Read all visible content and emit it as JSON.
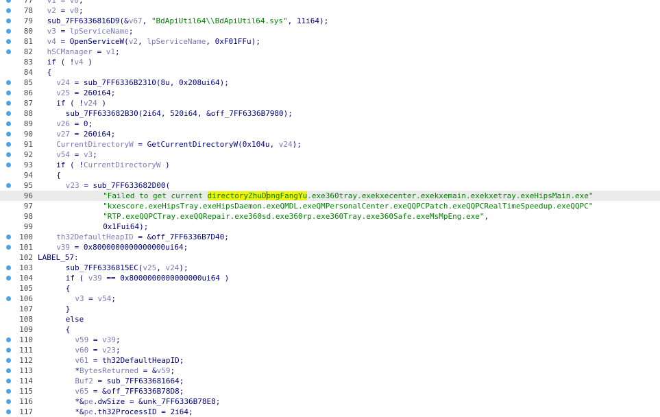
{
  "colors": {
    "background": "#ffffff",
    "breakpoint": "#4aa3e6",
    "code": "#000080",
    "variable": "#7a7ab8",
    "string": "#008000",
    "highlight": "#f2f200",
    "current_line": "#ebebeb"
  },
  "editor": {
    "cursor_line": 96,
    "lines": [
      {
        "n": "77",
        "bp": true,
        "indent": 2,
        "tokens": [
          [
            "var",
            "v1"
          ],
          [
            "plain",
            " = "
          ],
          [
            "var",
            "v0"
          ],
          [
            "plain",
            ";"
          ]
        ]
      },
      {
        "n": "78",
        "bp": true,
        "indent": 2,
        "tokens": [
          [
            "var",
            "v2"
          ],
          [
            "plain",
            " = "
          ],
          [
            "var",
            "v0"
          ],
          [
            "plain",
            ";"
          ]
        ]
      },
      {
        "n": "79",
        "bp": true,
        "indent": 2,
        "tokens": [
          [
            "plain",
            "sub_7FF6336816D9(&"
          ],
          [
            "var",
            "v67"
          ],
          [
            "plain",
            ", "
          ],
          [
            "str",
            "\"BdApiUtil64\\\\BdApiUtil64.sys\""
          ],
          [
            "plain",
            ", 11i64);"
          ]
        ]
      },
      {
        "n": "80",
        "bp": true,
        "indent": 2,
        "tokens": [
          [
            "var",
            "v3"
          ],
          [
            "plain",
            " = "
          ],
          [
            "var",
            "lpServiceName"
          ],
          [
            "plain",
            ";"
          ]
        ]
      },
      {
        "n": "81",
        "bp": true,
        "indent": 2,
        "tokens": [
          [
            "var",
            "v4"
          ],
          [
            "plain",
            " = OpenServiceW("
          ],
          [
            "var",
            "v2"
          ],
          [
            "plain",
            ", "
          ],
          [
            "var",
            "lpServiceName"
          ],
          [
            "plain",
            ", 0xF01FFu);"
          ]
        ]
      },
      {
        "n": "82",
        "bp": true,
        "indent": 2,
        "tokens": [
          [
            "var",
            "hSCManager"
          ],
          [
            "plain",
            " = "
          ],
          [
            "var",
            "v1"
          ],
          [
            "plain",
            ";"
          ]
        ]
      },
      {
        "n": "83",
        "bp": false,
        "indent": 2,
        "tokens": [
          [
            "plain",
            "if ( !"
          ],
          [
            "var",
            "v4"
          ],
          [
            "plain",
            " )"
          ]
        ]
      },
      {
        "n": "84",
        "bp": false,
        "indent": 2,
        "tokens": [
          [
            "plain",
            "{"
          ]
        ]
      },
      {
        "n": "85",
        "bp": true,
        "indent": 4,
        "tokens": [
          [
            "var",
            "v24"
          ],
          [
            "plain",
            " = sub_7FF6336B2310(8u, 0x208ui64);"
          ]
        ]
      },
      {
        "n": "86",
        "bp": true,
        "indent": 4,
        "tokens": [
          [
            "var",
            "v25"
          ],
          [
            "plain",
            " = 260i64;"
          ]
        ]
      },
      {
        "n": "87",
        "bp": true,
        "indent": 4,
        "tokens": [
          [
            "plain",
            "if ( !"
          ],
          [
            "var",
            "v24"
          ],
          [
            "plain",
            " )"
          ]
        ]
      },
      {
        "n": "88",
        "bp": true,
        "indent": 6,
        "tokens": [
          [
            "plain",
            "sub_7FF633682B30(2i64, 520i64, &off_7FF6336B7980);"
          ]
        ]
      },
      {
        "n": "89",
        "bp": true,
        "indent": 4,
        "tokens": [
          [
            "var",
            "v26"
          ],
          [
            "plain",
            " = 0;"
          ]
        ]
      },
      {
        "n": "90",
        "bp": true,
        "indent": 4,
        "tokens": [
          [
            "var",
            "v27"
          ],
          [
            "plain",
            " = 260i64;"
          ]
        ]
      },
      {
        "n": "91",
        "bp": true,
        "indent": 4,
        "tokens": [
          [
            "var",
            "CurrentDirectoryW"
          ],
          [
            "plain",
            " = GetCurrentDirectoryW(0x104u, "
          ],
          [
            "var",
            "v24"
          ],
          [
            "plain",
            ");"
          ]
        ]
      },
      {
        "n": "92",
        "bp": true,
        "indent": 4,
        "tokens": [
          [
            "var",
            "v54"
          ],
          [
            "plain",
            " = "
          ],
          [
            "var",
            "v3"
          ],
          [
            "plain",
            ";"
          ]
        ]
      },
      {
        "n": "93",
        "bp": true,
        "indent": 4,
        "tokens": [
          [
            "plain",
            "if ( !"
          ],
          [
            "var",
            "CurrentDirectoryW"
          ],
          [
            "plain",
            " )"
          ]
        ]
      },
      {
        "n": "94",
        "bp": false,
        "indent": 4,
        "tokens": [
          [
            "plain",
            "{"
          ]
        ]
      },
      {
        "n": "95",
        "bp": true,
        "indent": 6,
        "tokens": [
          [
            "var",
            "v23"
          ],
          [
            "plain",
            " = sub_7FF633682D00("
          ]
        ]
      },
      {
        "n": "96",
        "bp": false,
        "indent": 14,
        "tokens": [
          [
            "str",
            "\"Failed to get current "
          ],
          [
            "hl",
            "directoryZhuDongFangYu"
          ],
          [
            "str",
            ".exe360tray.exekxecenter.exekxemain.exekxetray.exeHipsMain.exe\""
          ]
        ]
      },
      {
        "n": "97",
        "bp": false,
        "indent": 14,
        "tokens": [
          [
            "str",
            "\"kxescore.exeHipsTray.exeHipsDaemon.exeQMDL.exeQMPersonalCenter.exeQQPCPatch.exeQQPCRealTimeSpeedup.exeQQPC\""
          ]
        ]
      },
      {
        "n": "98",
        "bp": false,
        "indent": 14,
        "tokens": [
          [
            "str",
            "\"RTP.exeQQPCTray.exeQQRepair.exe360sd.exe360rp.exe360Tray.exe360Safe.exeMsMpEng.exe\""
          ],
          [
            "plain",
            ","
          ]
        ]
      },
      {
        "n": "99",
        "bp": false,
        "indent": 14,
        "tokens": [
          [
            "plain",
            "0x1Fui64);"
          ]
        ]
      },
      {
        "n": "100",
        "bp": true,
        "indent": 4,
        "tokens": [
          [
            "var",
            "th32DefaultHeapID"
          ],
          [
            "plain",
            " = &off_7FF6336B7D40;"
          ]
        ]
      },
      {
        "n": "101",
        "bp": true,
        "indent": 4,
        "tokens": [
          [
            "var",
            "v39"
          ],
          [
            "plain",
            " = 0x8000000000000000ui64;"
          ]
        ]
      },
      {
        "n": "102",
        "bp": false,
        "indent": 0,
        "tokens": [
          [
            "plain",
            "LABEL_57:"
          ]
        ]
      },
      {
        "n": "103",
        "bp": true,
        "indent": 6,
        "tokens": [
          [
            "plain",
            "sub_7FF6336815EC("
          ],
          [
            "var",
            "v25"
          ],
          [
            "plain",
            ", "
          ],
          [
            "var",
            "v24"
          ],
          [
            "plain",
            ");"
          ]
        ]
      },
      {
        "n": "104",
        "bp": true,
        "indent": 6,
        "tokens": [
          [
            "plain",
            "if ( "
          ],
          [
            "var",
            "v39"
          ],
          [
            "plain",
            " == 0x8000000000000000ui64 )"
          ]
        ]
      },
      {
        "n": "105",
        "bp": false,
        "indent": 6,
        "tokens": [
          [
            "plain",
            "{"
          ]
        ]
      },
      {
        "n": "106",
        "bp": true,
        "indent": 8,
        "tokens": [
          [
            "var",
            "v3"
          ],
          [
            "plain",
            " = "
          ],
          [
            "var",
            "v54"
          ],
          [
            "plain",
            ";"
          ]
        ]
      },
      {
        "n": "107",
        "bp": false,
        "indent": 6,
        "tokens": [
          [
            "plain",
            "}"
          ]
        ]
      },
      {
        "n": "108",
        "bp": false,
        "indent": 6,
        "tokens": [
          [
            "plain",
            "else"
          ]
        ]
      },
      {
        "n": "109",
        "bp": false,
        "indent": 6,
        "tokens": [
          [
            "plain",
            "{"
          ]
        ]
      },
      {
        "n": "110",
        "bp": true,
        "indent": 8,
        "tokens": [
          [
            "var",
            "v59"
          ],
          [
            "plain",
            " = "
          ],
          [
            "var",
            "v39"
          ],
          [
            "plain",
            ";"
          ]
        ]
      },
      {
        "n": "111",
        "bp": true,
        "indent": 8,
        "tokens": [
          [
            "var",
            "v60"
          ],
          [
            "plain",
            " = "
          ],
          [
            "var",
            "v23"
          ],
          [
            "plain",
            ";"
          ]
        ]
      },
      {
        "n": "112",
        "bp": true,
        "indent": 8,
        "tokens": [
          [
            "var",
            "v61"
          ],
          [
            "plain",
            " = th32DefaultHeapID;"
          ]
        ]
      },
      {
        "n": "113",
        "bp": true,
        "indent": 8,
        "tokens": [
          [
            "plain",
            "*"
          ],
          [
            "var",
            "BytesReturned"
          ],
          [
            "plain",
            " = &"
          ],
          [
            "var",
            "v59"
          ],
          [
            "plain",
            ";"
          ]
        ]
      },
      {
        "n": "114",
        "bp": true,
        "indent": 8,
        "tokens": [
          [
            "var",
            "Buf2"
          ],
          [
            "plain",
            " = sub_7FF633681664;"
          ]
        ]
      },
      {
        "n": "115",
        "bp": true,
        "indent": 8,
        "tokens": [
          [
            "var",
            "v65"
          ],
          [
            "plain",
            " = &off_7FF6336B78D8;"
          ]
        ]
      },
      {
        "n": "116",
        "bp": true,
        "indent": 8,
        "tokens": [
          [
            "plain",
            "*&"
          ],
          [
            "var",
            "pe"
          ],
          [
            "plain",
            ".dwSize = &unk_7FF6336B78E8;"
          ]
        ]
      },
      {
        "n": "117",
        "bp": true,
        "indent": 8,
        "tokens": [
          [
            "plain",
            "*&"
          ],
          [
            "var",
            "pe"
          ],
          [
            "plain",
            ".th32ProcessID = 2i64;"
          ]
        ]
      }
    ]
  }
}
